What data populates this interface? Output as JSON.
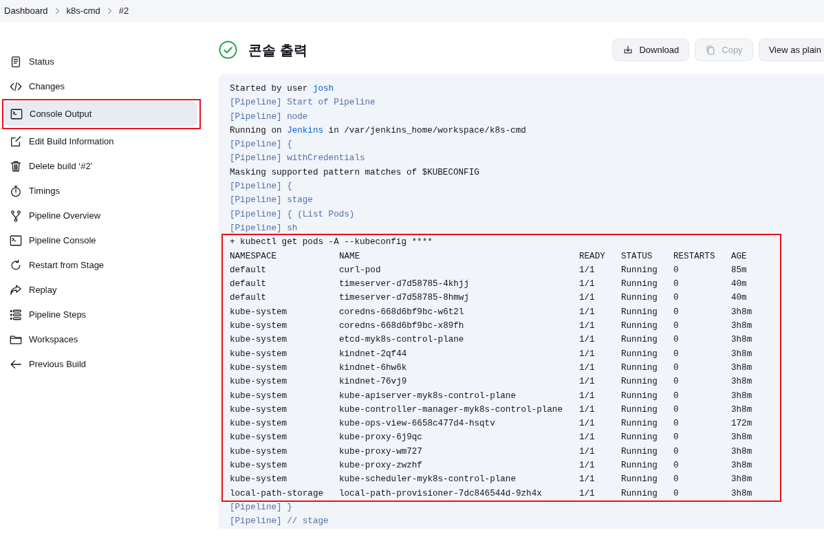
{
  "breadcrumbs": [
    "Dashboard",
    "k8s-cmd",
    "#2"
  ],
  "sidebar": {
    "items": [
      {
        "label": "Status",
        "selected": false,
        "annotated": false
      },
      {
        "label": "Changes",
        "selected": false,
        "annotated": false
      },
      {
        "label": "Console Output",
        "selected": true,
        "annotated": true
      },
      {
        "label": "Edit Build Information",
        "selected": false,
        "annotated": false
      },
      {
        "label": "Delete build ‘#2’",
        "selected": false,
        "annotated": false
      },
      {
        "label": "Timings",
        "selected": false,
        "annotated": false
      },
      {
        "label": "Pipeline Overview",
        "selected": false,
        "annotated": false
      },
      {
        "label": "Pipeline Console",
        "selected": false,
        "annotated": false
      },
      {
        "label": "Restart from Stage",
        "selected": false,
        "annotated": false
      },
      {
        "label": "Replay",
        "selected": false,
        "annotated": false
      },
      {
        "label": "Pipeline Steps",
        "selected": false,
        "annotated": false
      },
      {
        "label": "Workspaces",
        "selected": false,
        "annotated": false
      },
      {
        "label": "Previous Build",
        "selected": false,
        "annotated": false
      }
    ]
  },
  "header": {
    "title": "콘솔 출력",
    "succeeded": true,
    "buttons": [
      {
        "label": "Download",
        "disabled": false
      },
      {
        "label": "Copy",
        "disabled": true
      },
      {
        "label": "View as plain",
        "disabled": false
      }
    ]
  },
  "console": {
    "lines_before": [
      {
        "kind": "plain",
        "parts": [
          {
            "text": "Started by user "
          },
          {
            "text": "josh",
            "link": true
          }
        ]
      },
      {
        "kind": "pipeline",
        "parts": [
          {
            "text": "[Pipeline] Start of Pipeline"
          }
        ]
      },
      {
        "kind": "pipeline",
        "parts": [
          {
            "text": "[Pipeline] node"
          }
        ]
      },
      {
        "kind": "plain",
        "parts": [
          {
            "text": "Running on "
          },
          {
            "text": "Jenkins",
            "link": true
          },
          {
            "text": " in /var/jenkins_home/workspace/k8s-cmd"
          }
        ]
      },
      {
        "kind": "pipeline",
        "parts": [
          {
            "text": "[Pipeline] {"
          }
        ]
      },
      {
        "kind": "pipeline",
        "parts": [
          {
            "text": "[Pipeline] withCredentials"
          }
        ]
      },
      {
        "kind": "plain",
        "parts": [
          {
            "text": "Masking supported pattern matches of $KUBECONFIG"
          }
        ]
      },
      {
        "kind": "pipeline",
        "parts": [
          {
            "text": "[Pipeline] {"
          }
        ]
      },
      {
        "kind": "pipeline",
        "parts": [
          {
            "text": "[Pipeline] stage"
          }
        ]
      },
      {
        "kind": "pipeline",
        "parts": [
          {
            "text": "[Pipeline] { (List Pods)"
          }
        ]
      },
      {
        "kind": "pipeline",
        "parts": [
          {
            "text": "[Pipeline] sh"
          }
        ]
      }
    ],
    "command_block": {
      "annotated": true,
      "command": "+ kubectl get pods -A --kubeconfig ****",
      "columns": [
        "NAMESPACE",
        "NAME",
        "READY",
        "STATUS",
        "RESTARTS",
        "AGE"
      ],
      "rows": [
        [
          "default",
          "curl-pod",
          "1/1",
          "Running",
          "0",
          "85m"
        ],
        [
          "default",
          "timeserver-d7d58785-4khjj",
          "1/1",
          "Running",
          "0",
          "40m"
        ],
        [
          "default",
          "timeserver-d7d58785-8hmwj",
          "1/1",
          "Running",
          "0",
          "40m"
        ],
        [
          "kube-system",
          "coredns-668d6bf9bc-w6t2l",
          "1/1",
          "Running",
          "0",
          "3h8m"
        ],
        [
          "kube-system",
          "coredns-668d6bf9bc-x89fh",
          "1/1",
          "Running",
          "0",
          "3h8m"
        ],
        [
          "kube-system",
          "etcd-myk8s-control-plane",
          "1/1",
          "Running",
          "0",
          "3h8m"
        ],
        [
          "kube-system",
          "kindnet-2qf44",
          "1/1",
          "Running",
          "0",
          "3h8m"
        ],
        [
          "kube-system",
          "kindnet-6hw6k",
          "1/1",
          "Running",
          "0",
          "3h8m"
        ],
        [
          "kube-system",
          "kindnet-76vj9",
          "1/1",
          "Running",
          "0",
          "3h8m"
        ],
        [
          "kube-system",
          "kube-apiserver-myk8s-control-plane",
          "1/1",
          "Running",
          "0",
          "3h8m"
        ],
        [
          "kube-system",
          "kube-controller-manager-myk8s-control-plane",
          "1/1",
          "Running",
          "0",
          "3h8m"
        ],
        [
          "kube-system",
          "kube-ops-view-6658c477d4-hsqtv",
          "1/1",
          "Running",
          "0",
          "172m"
        ],
        [
          "kube-system",
          "kube-proxy-6j9qc",
          "1/1",
          "Running",
          "0",
          "3h8m"
        ],
        [
          "kube-system",
          "kube-proxy-wm727",
          "1/1",
          "Running",
          "0",
          "3h8m"
        ],
        [
          "kube-system",
          "kube-proxy-zwzhf",
          "1/1",
          "Running",
          "0",
          "3h8m"
        ],
        [
          "kube-system",
          "kube-scheduler-myk8s-control-plane",
          "1/1",
          "Running",
          "0",
          "3h8m"
        ],
        [
          "local-path-storage",
          "local-path-provisioner-7dc846544d-9zh4x",
          "1/1",
          "Running",
          "0",
          "3h8m"
        ]
      ]
    },
    "lines_after": [
      {
        "kind": "pipeline",
        "parts": [
          {
            "text": "[Pipeline] }"
          }
        ]
      },
      {
        "kind": "pipeline",
        "parts": [
          {
            "text": "[Pipeline] // stage"
          }
        ]
      }
    ]
  }
}
